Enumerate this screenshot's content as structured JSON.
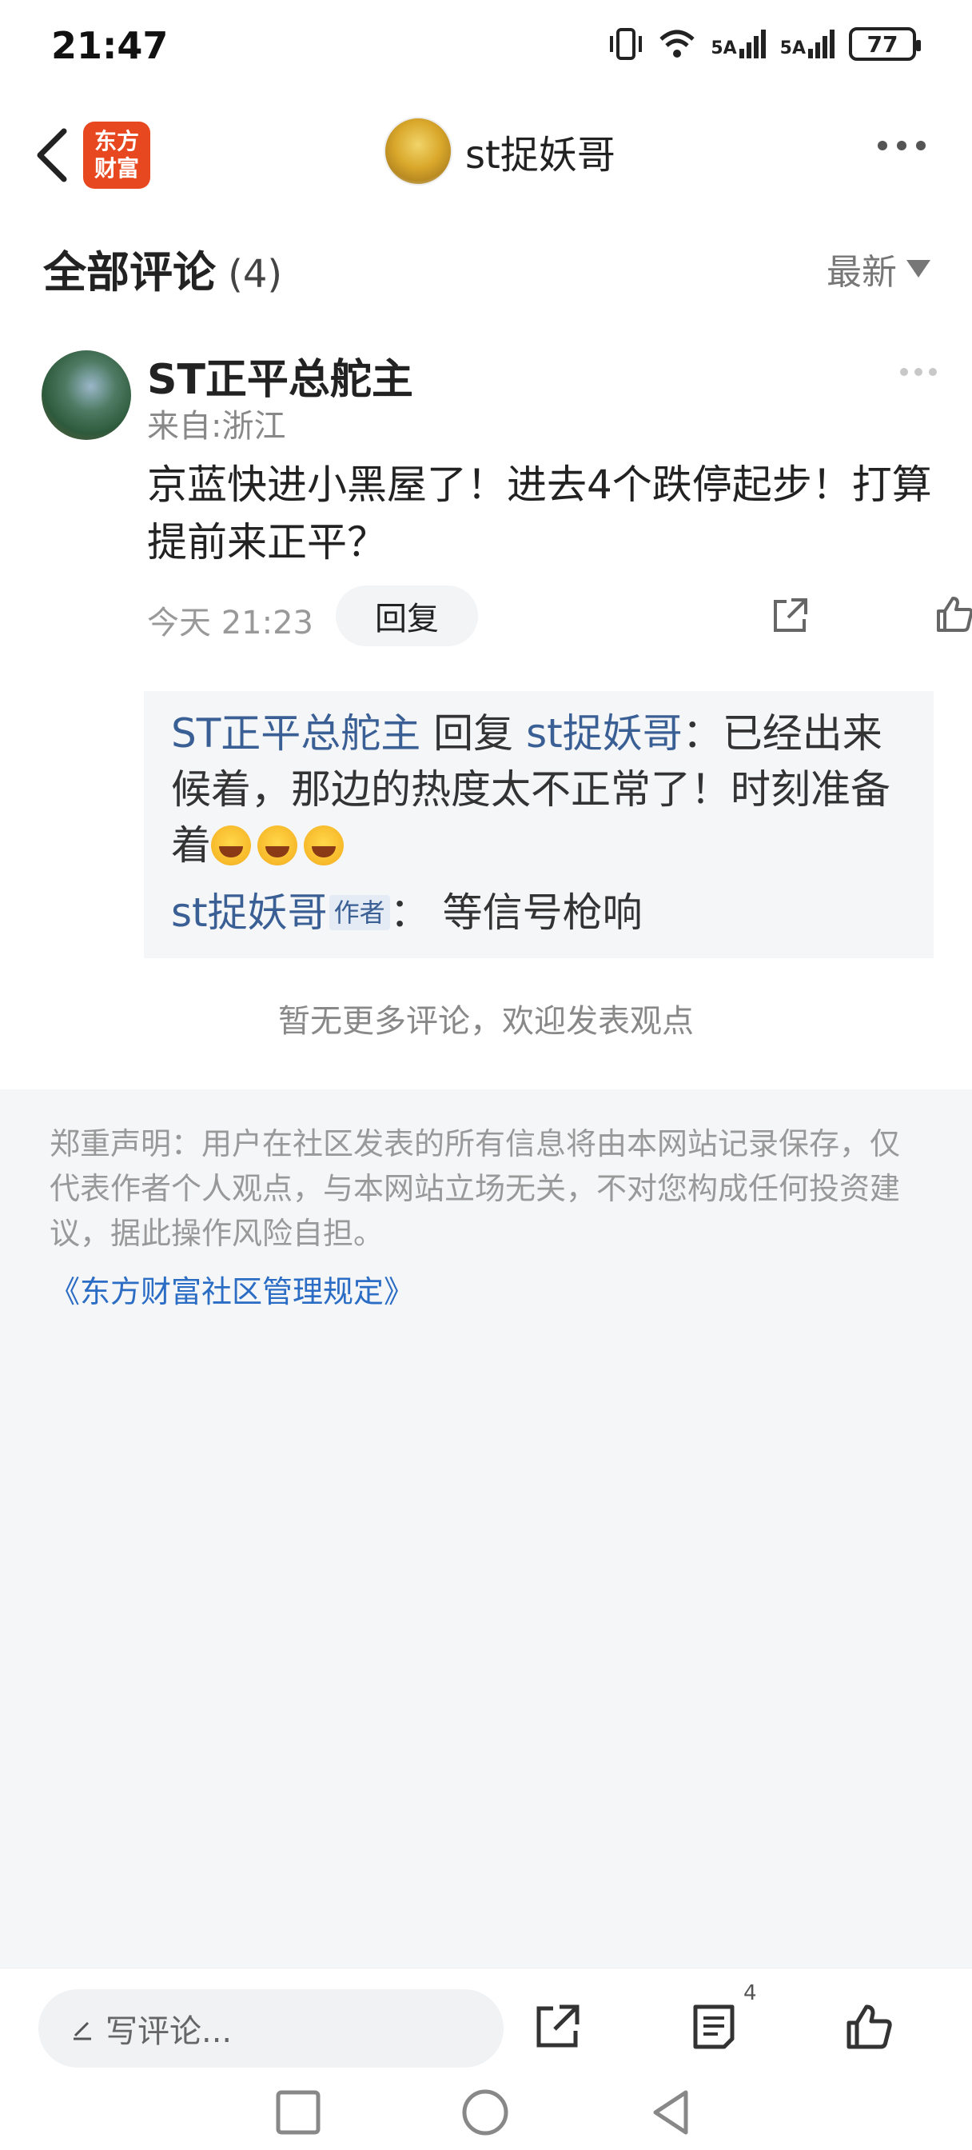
{
  "status_bar": {
    "time": "21:47",
    "battery": "77",
    "signal1": "5A",
    "signal2": "5A",
    "icons": [
      "vibrate-icon",
      "wifi-icon",
      "signal-icon",
      "signal-icon",
      "battery-icon"
    ]
  },
  "nav": {
    "logo_line1": "东方",
    "logo_line2": "财富",
    "title": "st捉妖哥"
  },
  "comments": {
    "title": "全部评论",
    "count": "(4)",
    "sort": "最新"
  },
  "comment": {
    "author": "ST正平总舵主",
    "location": "来自:浙江",
    "text": "京蓝快进小黑屋了！进去4个跌停起步！打算提前来正平？",
    "time": "今天 21:23",
    "reply_label": "回复"
  },
  "replies": {
    "r1_author": "ST正平总舵主",
    "r1_verb": " 回复 ",
    "r1_target": "st捉妖哥",
    "r1_text": "：已经出来候着，那边的热度太不正常了！时刻准备着",
    "r2_author": "st捉妖哥",
    "r2_badge": "作者",
    "r2_text": "： 等信号枪响"
  },
  "no_more": "暂无更多评论，欢迎发表观点",
  "disclaimer": {
    "text": "郑重声明：用户在社区发表的所有信息将由本网站记录保存，仅代表作者个人观点，与本网站立场无关，不对您构成任何投资建议，据此操作风险自担。",
    "link": "《东方财富社区管理规定》"
  },
  "bottom_bar": {
    "placeholder": "写评论...",
    "comment_count": "4"
  },
  "colors": {
    "accent_blue": "#3a5f95",
    "link_blue": "#2b6cc4",
    "brand_orange": "#e8481f"
  }
}
